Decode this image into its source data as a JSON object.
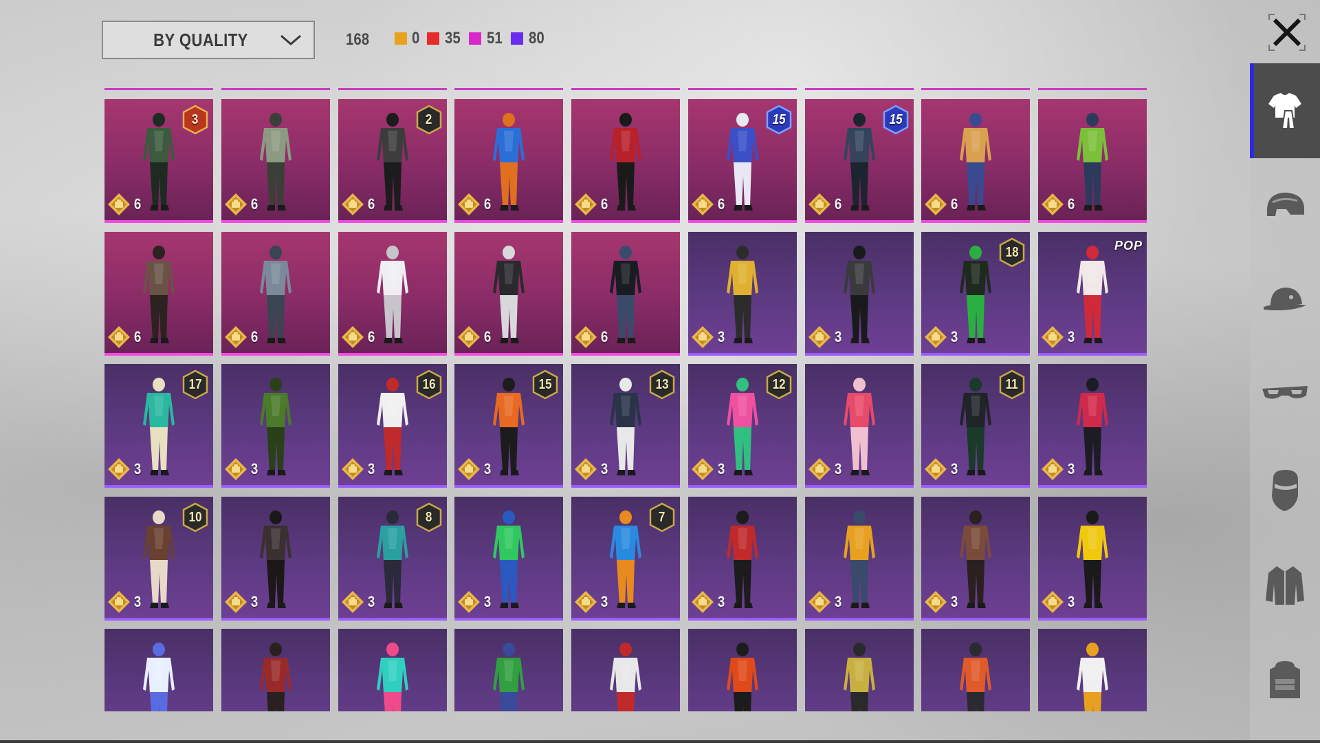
{
  "sort": {
    "label": "BY QUALITY"
  },
  "totals": {
    "total": "168",
    "quality_counts": [
      {
        "color": "#e8a21c",
        "count": "0"
      },
      {
        "color": "#e62b2b",
        "count": "35"
      },
      {
        "color": "#d928c9",
        "count": "51"
      },
      {
        "color": "#6a2df0",
        "count": "80"
      }
    ]
  },
  "categories": [
    {
      "icon": "outfit-icon",
      "active": true
    },
    {
      "icon": "helmet-icon",
      "active": false
    },
    {
      "icon": "cap-icon",
      "active": false
    },
    {
      "icon": "mask-icon",
      "active": false
    },
    {
      "icon": "face-cover-icon",
      "active": false
    },
    {
      "icon": "jacket-icon",
      "active": false
    },
    {
      "icon": "backpack-icon",
      "active": false
    }
  ],
  "items": [
    {
      "tier": "mythic",
      "points": "6",
      "badge": "3",
      "badge_style": "red",
      "c1": "#3b5a3e",
      "c2": "#1d2b22"
    },
    {
      "tier": "mythic",
      "points": "6",
      "badge": "",
      "badge_style": "",
      "c1": "#8c9a82",
      "c2": "#3a3f37"
    },
    {
      "tier": "mythic",
      "points": "6",
      "badge": "2",
      "badge_style": "gold",
      "c1": "#3c3c3c",
      "c2": "#1c1c1c"
    },
    {
      "tier": "mythic",
      "points": "6",
      "badge": "",
      "badge_style": "",
      "c1": "#2a6fd8",
      "c2": "#e07020"
    },
    {
      "tier": "mythic",
      "points": "6",
      "badge": "",
      "badge_style": "",
      "c1": "#b8202a",
      "c2": "#1a1a1a"
    },
    {
      "tier": "mythic",
      "points": "6",
      "badge": "15",
      "badge_style": "blue",
      "c1": "#3a4fc8",
      "c2": "#e8e8f4"
    },
    {
      "tier": "mythic",
      "points": "6",
      "badge": "15",
      "badge_style": "blue",
      "c1": "#34445c",
      "c2": "#1c2430"
    },
    {
      "tier": "mythic",
      "points": "6",
      "badge": "",
      "badge_style": "",
      "c1": "#d9a050",
      "c2": "#3a4a90"
    },
    {
      "tier": "mythic",
      "points": "6",
      "badge": "",
      "badge_style": "",
      "c1": "#7cc03a",
      "c2": "#2c3a5c"
    },
    {
      "tier": "mythic",
      "points": "6",
      "badge": "",
      "badge_style": "",
      "c1": "#6a5246",
      "c2": "#2c2220"
    },
    {
      "tier": "mythic",
      "points": "6",
      "badge": "",
      "badge_style": "",
      "c1": "#7a8a9a",
      "c2": "#3a4452"
    },
    {
      "tier": "mythic",
      "points": "6",
      "badge": "",
      "badge_style": "",
      "c1": "#f0eef2",
      "c2": "#c8c4cc"
    },
    {
      "tier": "mythic",
      "points": "6",
      "badge": "",
      "badge_style": "",
      "c1": "#2a2a2e",
      "c2": "#d8d8dc"
    },
    {
      "tier": "mythic",
      "points": "6",
      "badge": "",
      "badge_style": "",
      "c1": "#1a1c24",
      "c2": "#3a4a6a"
    },
    {
      "tier": "legend",
      "points": "3",
      "badge": "",
      "badge_style": "",
      "c1": "#e0b030",
      "c2": "#2c2c2c"
    },
    {
      "tier": "legend",
      "points": "3",
      "badge": "",
      "badge_style": "",
      "c1": "#3a3a3c",
      "c2": "#1a1a1c"
    },
    {
      "tier": "legend",
      "points": "3",
      "badge": "18",
      "badge_style": "gold",
      "c1": "#1e2a1e",
      "c2": "#2ab040"
    },
    {
      "tier": "legend",
      "points": "3",
      "badge": "",
      "badge_style": "",
      "pop": "POP",
      "c1": "#f2e8e8",
      "c2": "#d02a3a"
    },
    {
      "tier": "legend",
      "points": "3",
      "badge": "17",
      "badge_style": "gold",
      "c1": "#2ab8a0",
      "c2": "#e8e0c0"
    },
    {
      "tier": "legend",
      "points": "3",
      "badge": "",
      "badge_style": "",
      "c1": "#4a7a2a",
      "c2": "#2a4018"
    },
    {
      "tier": "legend",
      "points": "3",
      "badge": "16",
      "badge_style": "gold",
      "c1": "#f0f0f0",
      "c2": "#c02a2a"
    },
    {
      "tier": "legend",
      "points": "3",
      "badge": "15",
      "badge_style": "gold",
      "c1": "#e86a20",
      "c2": "#1c1c1c"
    },
    {
      "tier": "legend",
      "points": "3",
      "badge": "13",
      "badge_style": "gold",
      "c1": "#2a3448",
      "c2": "#e8e8e8"
    },
    {
      "tier": "legend",
      "points": "3",
      "badge": "12",
      "badge_style": "gold",
      "c1": "#f050a0",
      "c2": "#30c080"
    },
    {
      "tier": "legend",
      "points": "3",
      "badge": "",
      "badge_style": "",
      "c1": "#e84a6a",
      "c2": "#f0c0d0"
    },
    {
      "tier": "legend",
      "points": "3",
      "badge": "11",
      "badge_style": "gold",
      "c1": "#202428",
      "c2": "#1a3a2a"
    },
    {
      "tier": "legend",
      "points": "3",
      "badge": "",
      "badge_style": "",
      "c1": "#d02a4a",
      "c2": "#1c1c24"
    },
    {
      "tier": "legend",
      "points": "3",
      "badge": "10",
      "badge_style": "gold",
      "c1": "#6a4030",
      "c2": "#e8d8c8"
    },
    {
      "tier": "legend",
      "points": "3",
      "badge": "",
      "badge_style": "",
      "c1": "#3a3030",
      "c2": "#1c1818"
    },
    {
      "tier": "legend",
      "points": "3",
      "badge": "8",
      "badge_style": "gold",
      "c1": "#2aa0a0",
      "c2": "#2a2a3a"
    },
    {
      "tier": "legend",
      "points": "3",
      "badge": "",
      "badge_style": "",
      "c1": "#30c860",
      "c2": "#2a5ac0"
    },
    {
      "tier": "legend",
      "points": "3",
      "badge": "7",
      "badge_style": "gold",
      "c1": "#2a8ae0",
      "c2": "#e88a20"
    },
    {
      "tier": "legend",
      "points": "3",
      "badge": "",
      "badge_style": "",
      "c1": "#c02a2a",
      "c2": "#1c1c1c"
    },
    {
      "tier": "legend",
      "points": "3",
      "badge": "",
      "badge_style": "",
      "c1": "#e8a020",
      "c2": "#3a4a6a"
    },
    {
      "tier": "legend",
      "points": "3",
      "badge": "",
      "badge_style": "",
      "c1": "#7a4a3a",
      "c2": "#2a2020"
    },
    {
      "tier": "legend",
      "points": "3",
      "badge": "",
      "badge_style": "",
      "c1": "#f0c810",
      "c2": "#1a1a1a"
    },
    {
      "tier": "legend",
      "points": "",
      "badge": "",
      "badge_style": "",
      "c1": "#e8f0ff",
      "c2": "#5a6ae0"
    },
    {
      "tier": "legend",
      "points": "",
      "badge": "",
      "badge_style": "",
      "c1": "#9a2a2a",
      "c2": "#2a2020"
    },
    {
      "tier": "legend",
      "points": "",
      "badge": "",
      "badge_style": "",
      "c1": "#30d0c0",
      "c2": "#f04a8a"
    },
    {
      "tier": "legend",
      "points": "",
      "badge": "",
      "badge_style": "",
      "c1": "#30a040",
      "c2": "#3a4a9a"
    },
    {
      "tier": "legend",
      "points": "",
      "badge": "",
      "badge_style": "",
      "c1": "#e8e8e8",
      "c2": "#c02a2a"
    },
    {
      "tier": "legend",
      "points": "",
      "badge": "",
      "badge_style": "",
      "c1": "#e04a1a",
      "c2": "#1c1c1c"
    },
    {
      "tier": "legend",
      "points": "",
      "badge": "",
      "badge_style": "",
      "c1": "#c8b040",
      "c2": "#2a2a2a"
    },
    {
      "tier": "legend",
      "points": "",
      "badge": "",
      "badge_style": "",
      "c1": "#e05a2a",
      "c2": "#2a2a30"
    },
    {
      "tier": "legend",
      "points": "",
      "badge": "",
      "badge_style": "",
      "c1": "#f0f0f0",
      "c2": "#e8a020"
    }
  ]
}
